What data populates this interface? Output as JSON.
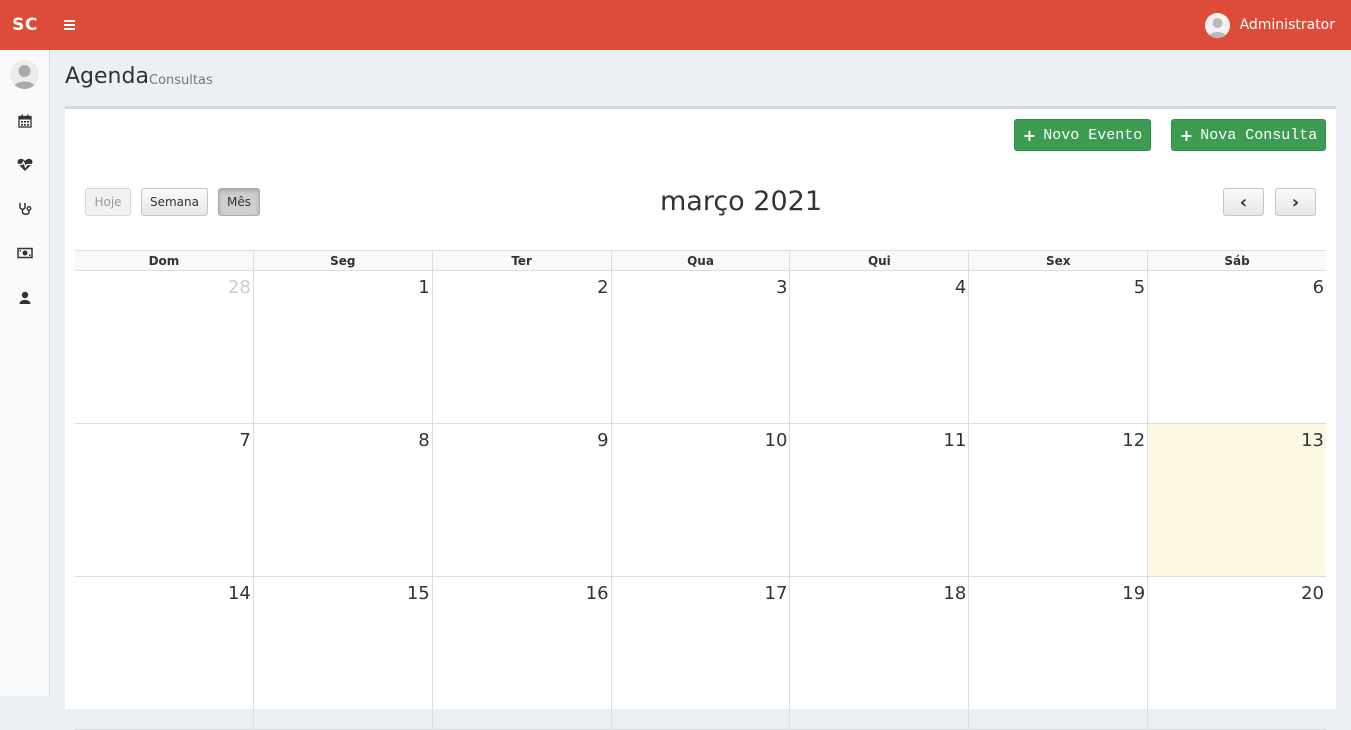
{
  "navbar": {
    "logo": "SC",
    "user_name": "Administrator",
    "accent_color": "#dd4b39"
  },
  "sidebar": {
    "items": [
      {
        "icon": "calendar-icon"
      },
      {
        "icon": "heartbeat-icon"
      },
      {
        "icon": "stethoscope-icon"
      },
      {
        "icon": "money-icon"
      },
      {
        "icon": "user-icon"
      }
    ]
  },
  "header": {
    "title": "Agenda",
    "subtitle": "Consultas"
  },
  "actions": {
    "novo_evento": "Novo Evento",
    "nova_consulta": "Nova Consulta"
  },
  "calendar": {
    "today_label": "Hoje",
    "week_label": "Semana",
    "month_label": "Mês",
    "title": "março 2021",
    "prev": "‹",
    "next": "›",
    "weekdays": [
      "Dom",
      "Seg",
      "Ter",
      "Qua",
      "Qui",
      "Sex",
      "Sáb"
    ],
    "weeks": [
      [
        "28",
        "1",
        "2",
        "3",
        "4",
        "5",
        "6"
      ],
      [
        "7",
        "8",
        "9",
        "10",
        "11",
        "12",
        "13"
      ],
      [
        "14",
        "15",
        "16",
        "17",
        "18",
        "19",
        "20"
      ]
    ],
    "today_color": "#fcf8e3"
  }
}
